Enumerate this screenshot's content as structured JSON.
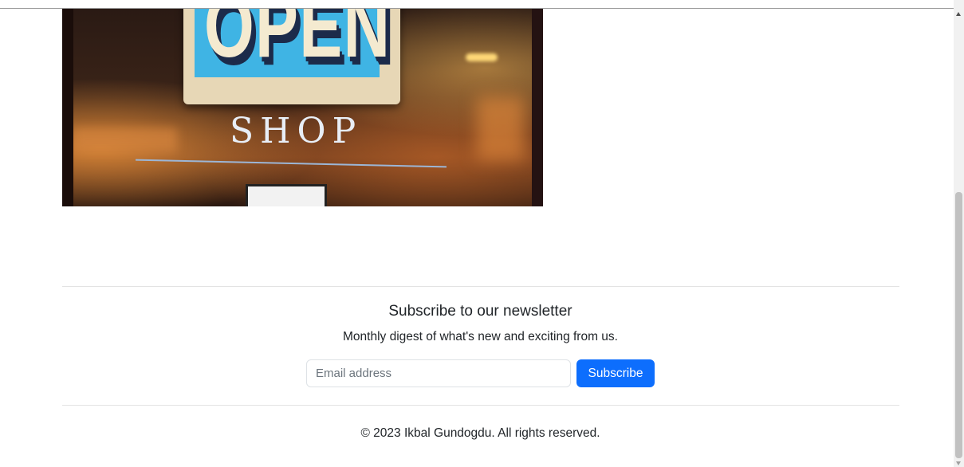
{
  "hero": {
    "sign_text": "OPEN",
    "shop_text": "SHOP"
  },
  "newsletter": {
    "title": "Subscribe to our newsletter",
    "subtitle": "Monthly digest of what's new and exciting from us.",
    "email_placeholder": "Email address",
    "email_value": "",
    "subscribe_label": "Subscribe"
  },
  "footer": {
    "copyright": "© 2023 Ikbal Gundogdu. All rights reserved."
  },
  "colors": {
    "primary": "#0d6efd",
    "text": "#212529",
    "muted": "#6c757d",
    "divider": "#e3e3e3"
  }
}
